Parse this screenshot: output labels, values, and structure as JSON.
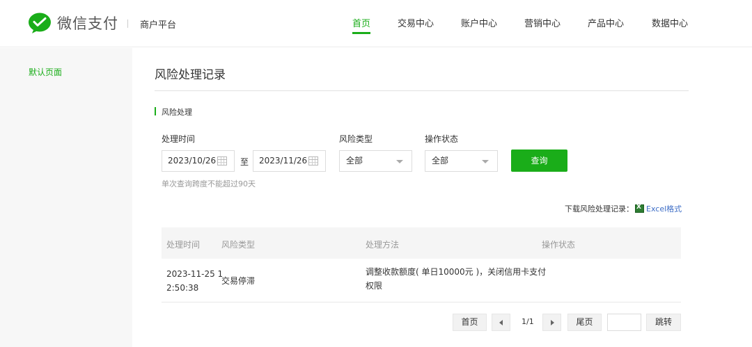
{
  "header": {
    "brand": "微信支付",
    "subtitle": "商户平台",
    "nav": [
      {
        "label": "首页",
        "active": true
      },
      {
        "label": "交易中心",
        "active": false
      },
      {
        "label": "账户中心",
        "active": false
      },
      {
        "label": "营销中心",
        "active": false
      },
      {
        "label": "产品中心",
        "active": false
      },
      {
        "label": "数据中心",
        "active": false
      }
    ]
  },
  "sidebar": {
    "items": [
      {
        "label": "默认页面",
        "active": true
      }
    ]
  },
  "main": {
    "title": "风险处理记录",
    "section_title": "风险处理",
    "filters": {
      "time_label": "处理时间",
      "start_date": "2023/10/26",
      "to_text": "至",
      "end_date": "2023/11/26",
      "risk_type_label": "风险类型",
      "risk_type_value": "全部",
      "status_label": "操作状态",
      "status_value": "全部",
      "query_button": "查询",
      "hint": "单次查询跨度不能超过90天"
    },
    "download": {
      "label": "下载风险处理记录：",
      "link": "Excel格式"
    },
    "table": {
      "columns": [
        "处理时间",
        "风险类型",
        "处理方法",
        "操作状态"
      ],
      "rows": [
        {
          "time_line1": "2023-11-25 1",
          "time_line2": "2:50:38",
          "risk_type": "交易停滞",
          "method_line1": "调整收款额度( 单日10000元 )，关闭信用卡支付",
          "method_line2": "权限",
          "status": ""
        }
      ]
    },
    "pagination": {
      "first": "首页",
      "page_info": "1/1",
      "last": "尾页",
      "jump_value": "",
      "jump": "跳转"
    }
  },
  "colors": {
    "accent": "#1aad19",
    "link": "#3d6dc6",
    "sidebar_bg": "#f7f7f7"
  },
  "icons": [
    "wechat-pay-logo-icon",
    "calendar-icon",
    "dropdown-caret-icon",
    "excel-icon",
    "prev-page-icon",
    "next-page-icon"
  ]
}
